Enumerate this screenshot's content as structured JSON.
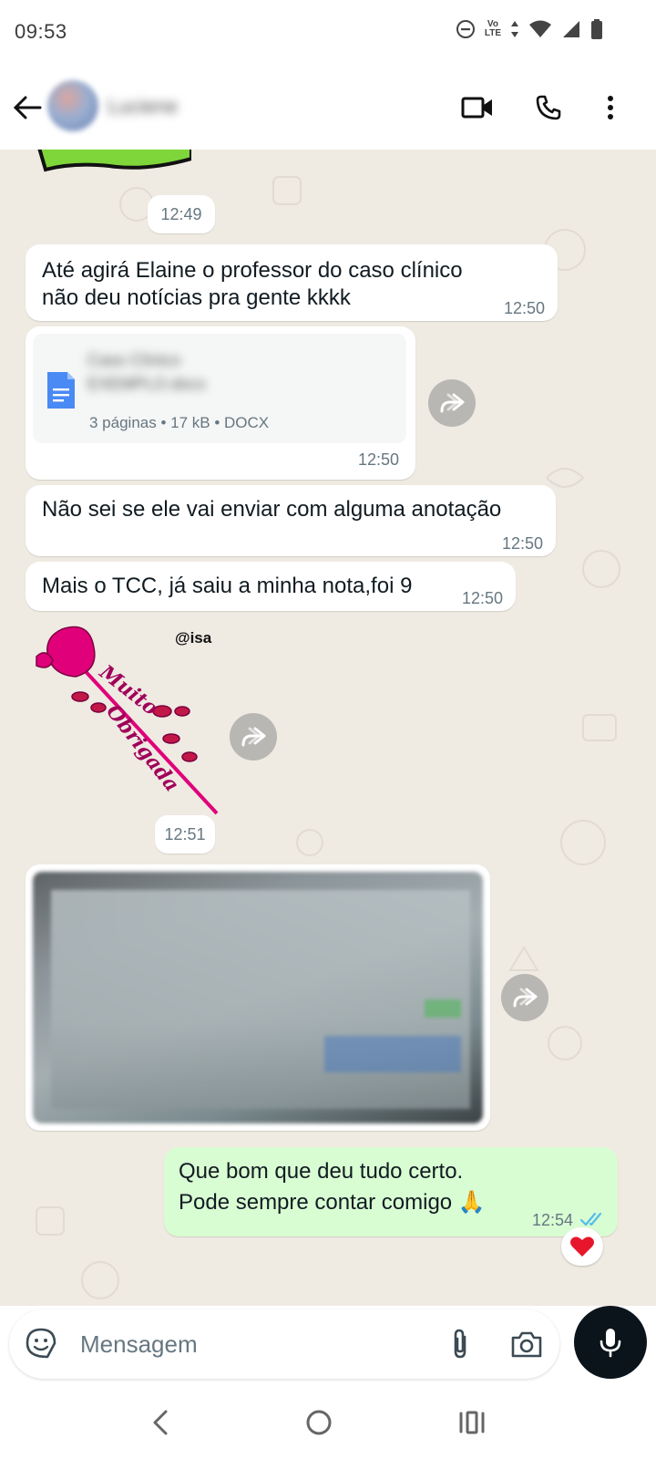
{
  "status_bar": {
    "time": "09:53",
    "network": "Vo LTE",
    "icons": [
      "do-not-disturb-icon",
      "volte-icon",
      "data-arrows-icon",
      "wifi-icon",
      "signal-icon",
      "battery-icon"
    ]
  },
  "header": {
    "contact_name": "Luciene",
    "icons": [
      "back-arrow-icon",
      "video-call-icon",
      "phone-icon",
      "more-vert-icon"
    ]
  },
  "messages": {
    "sticker_top_time": "12:49",
    "msg1_line1": "Até agirá Elaine o professor do caso clínico",
    "msg1_line2": "não deu notícias pra gente kkkk",
    "msg1_time": "12:50",
    "doc_name_line1": "Caso Clínico",
    "doc_name_line2": "EXEMPLO.docx",
    "doc_meta": "3 páginas • 17 kB • DOCX",
    "doc_time": "12:50",
    "msg2_text": "Não sei se ele vai enviar com alguma anotação",
    "msg2_time": "12:50",
    "msg3_text": "Mais o TCC, já saiu a minha nota,foi 9",
    "msg3_time": "12:50",
    "sticker_username": "@isa",
    "sticker_line1": "Muito",
    "sticker_line2": "Obrigada",
    "sticker_time": "12:51",
    "out_line1": "Que bom que deu tudo certo.",
    "out_line2": "Pode sempre contar comigo 🙏",
    "out_time": "12:54",
    "reaction": "❤️"
  },
  "input": {
    "placeholder": "Mensagem"
  },
  "colors": {
    "chat_bg": "#efeae2",
    "incoming": "#ffffff",
    "outgoing": "#d9fdd3",
    "read_ticks": "#53bdeb",
    "doc_blue": "#4a8af4",
    "mic_bg": "#0b141a"
  }
}
